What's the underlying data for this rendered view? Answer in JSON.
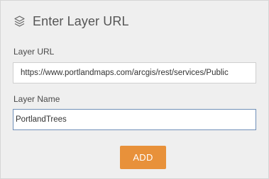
{
  "header": {
    "icon": "layers-icon",
    "title": "Enter Layer URL"
  },
  "form": {
    "url_label": "Layer URL",
    "url_value": "https://www.portlandmaps.com/arcgis/rest/services/Public",
    "name_label": "Layer Name",
    "name_value": "PortlandTrees",
    "add_label": "ADD"
  },
  "colors": {
    "panel_bg": "#efefef",
    "accent": "#e8913a",
    "focus_border": "#6f8fb8"
  }
}
